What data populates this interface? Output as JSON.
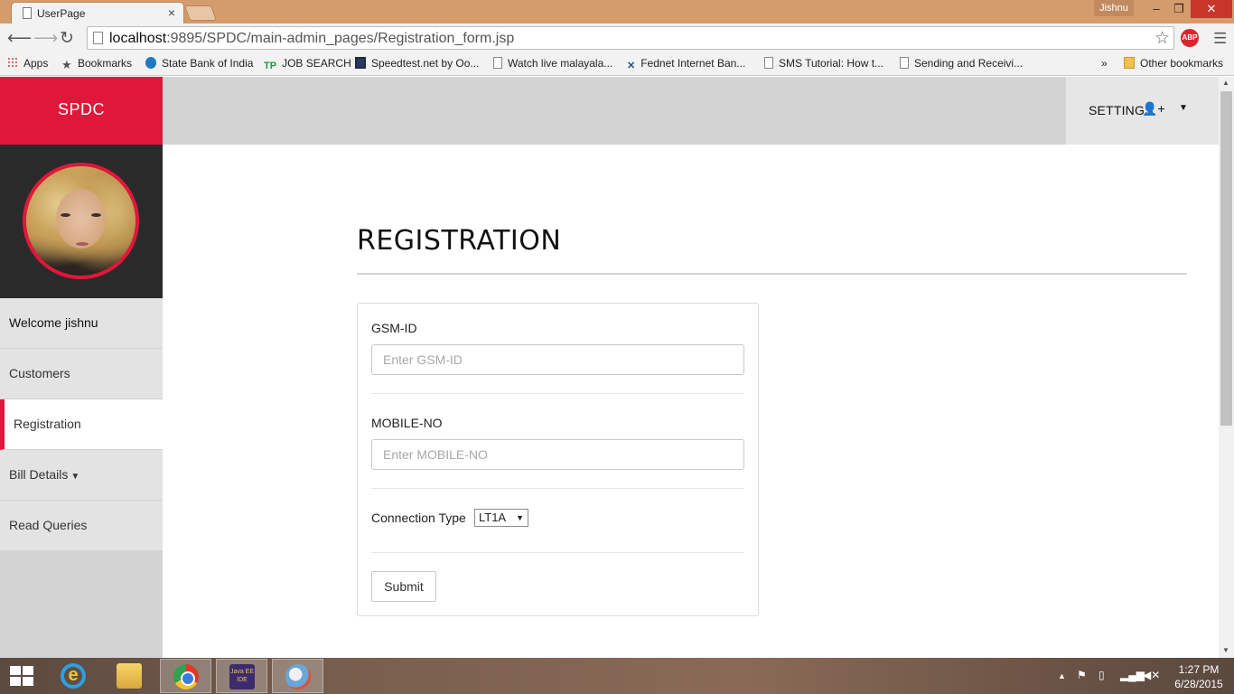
{
  "browser": {
    "tab_title": "UserPage",
    "tab_close": "×",
    "user_badge": "Jishnu",
    "window_controls": {
      "minimize": "–",
      "maximize": "❐",
      "close": "✕"
    },
    "url_host": "localhost",
    "url_rest": ":9895/SPDC/main-admin_pages/Registration_form.jsp",
    "abp_label": "ABP",
    "bookmarks": [
      {
        "label": "Apps",
        "icon": "apps-icon"
      },
      {
        "label": "Bookmarks",
        "icon": "star-icon"
      },
      {
        "label": "State Bank of India",
        "icon": "sbi-icon"
      },
      {
        "label": "JOB SEARCH",
        "icon": "tp-icon"
      },
      {
        "label": "Speedtest.net by Oo...",
        "icon": "speedtest-icon"
      },
      {
        "label": "Watch live malayala...",
        "icon": "page-icon"
      },
      {
        "label": "Fednet Internet Ban...",
        "icon": "fednet-icon"
      },
      {
        "label": "SMS Tutorial: How t...",
        "icon": "page-icon"
      },
      {
        "label": "Sending and Receivi...",
        "icon": "page-icon"
      }
    ],
    "bookmarks_overflow": "»",
    "other_bookmarks": "Other bookmarks"
  },
  "app": {
    "brand": "SPDC",
    "settings_label": "SETTINGS",
    "sidebar": {
      "welcome": "Welcome jishnu",
      "items": [
        {
          "label": "Customers"
        },
        {
          "label": "Registration",
          "active": true
        },
        {
          "label": "Bill Details",
          "dropdown": true
        },
        {
          "label": "Read Queries"
        }
      ]
    },
    "page_title": "REGISTRATION",
    "form": {
      "gsm_label": "GSM-ID",
      "gsm_placeholder": "Enter GSM-ID",
      "mobile_label": "MOBILE-NO",
      "mobile_placeholder": "Enter MOBILE-NO",
      "connection_label": "Connection Type",
      "connection_value": "LT1A",
      "submit_label": "Submit"
    },
    "accent_color": "#e0173b"
  },
  "taskbar": {
    "apps": [
      "internet-explorer-icon",
      "file-explorer-icon",
      "chrome-icon",
      "java-ee-ide-icon",
      "paint-icon"
    ],
    "javaee_label": "Java EE IDE",
    "time": "1:27 PM",
    "date": "6/28/2015"
  }
}
